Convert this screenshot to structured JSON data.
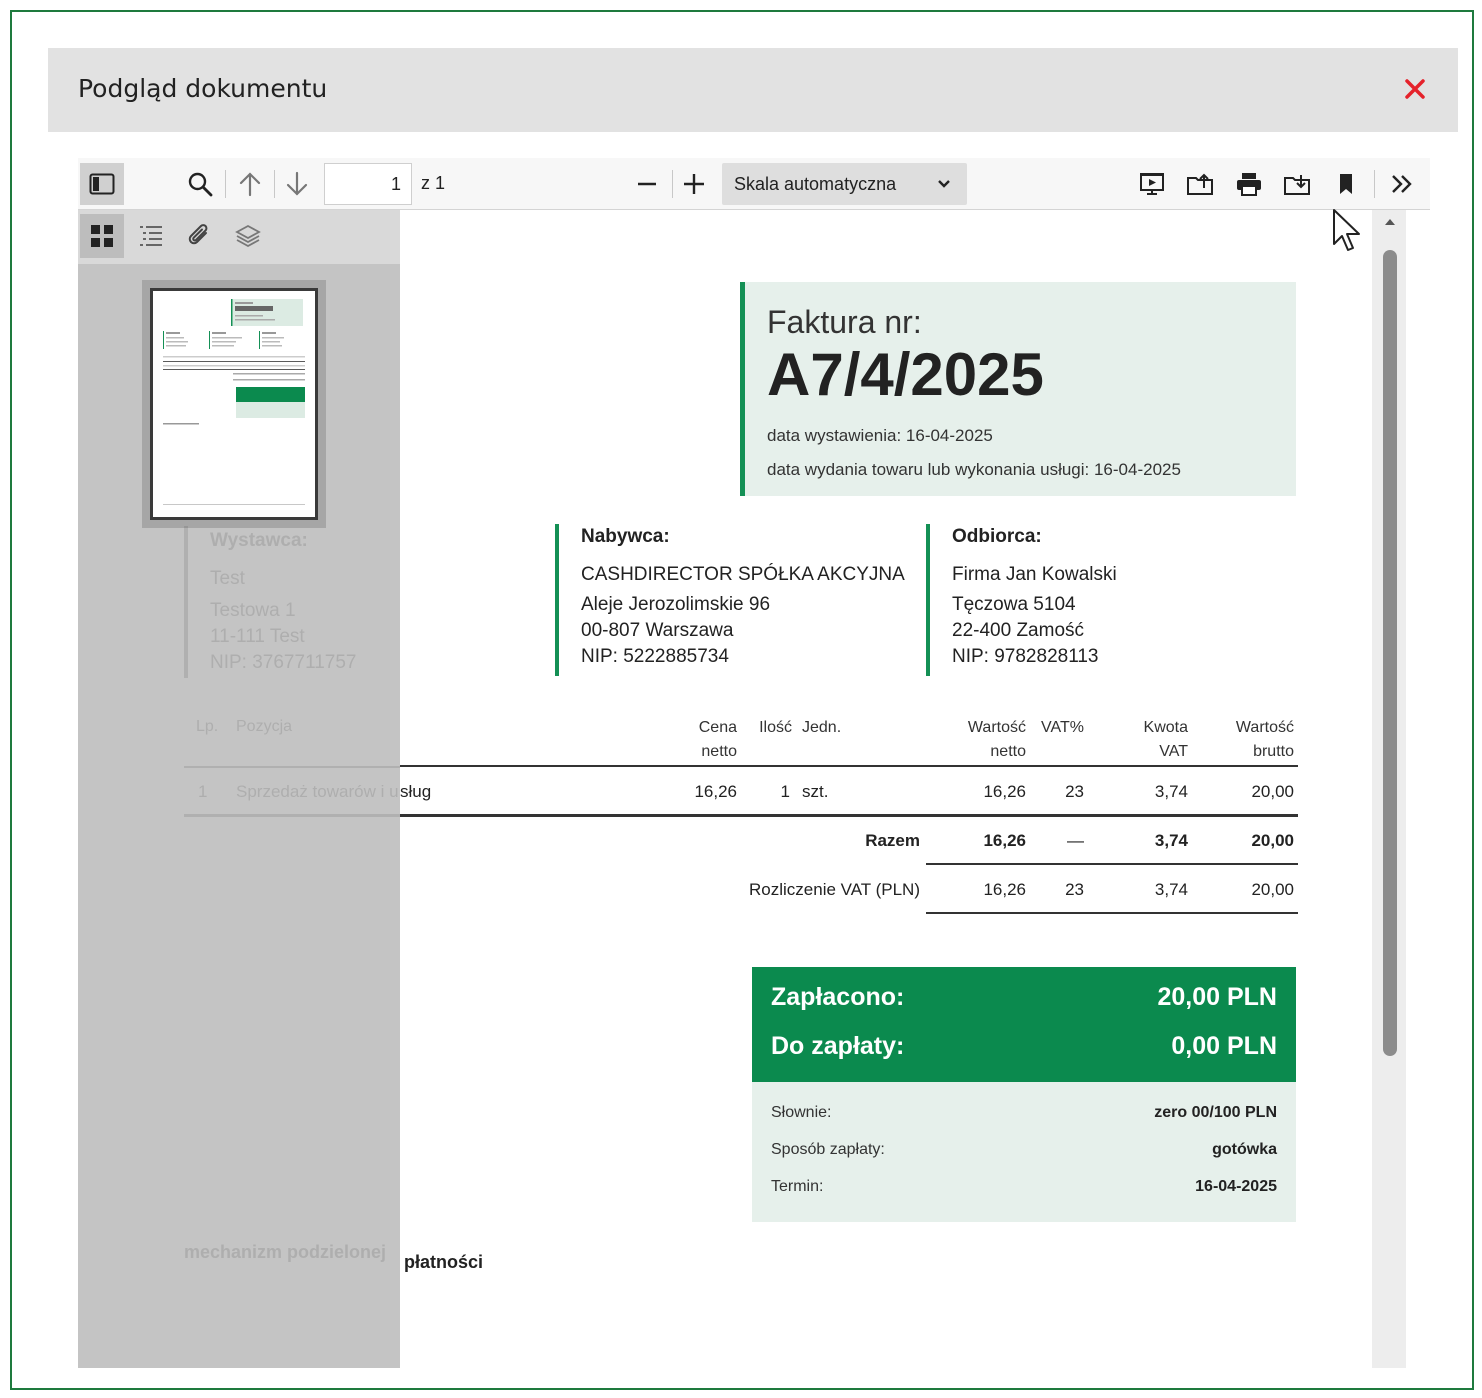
{
  "modal": {
    "title": "Podgląd dokumentu"
  },
  "toolbar": {
    "page_number": "1",
    "page_of": "z 1",
    "scale": "Skala automatyczna"
  },
  "invoice": {
    "label": "Faktura nr:",
    "number": "A7/4/2025",
    "issue_date": "data wystawienia: 16-04-2025",
    "delivery_date": "data wydania towaru lub wykonania usługi: 16-04-2025"
  },
  "buyer": {
    "title": "Nabywca:",
    "name": "CASHDIRECTOR SPÓŁKA AKCYJNA",
    "street": "Aleje Jerozolimskie 96",
    "city": "00-807 Warszawa",
    "nip": "NIP: 5222885734"
  },
  "recipient": {
    "title": "Odbiorca:",
    "name": "Firma Jan Kowalski",
    "street": "Tęczowa 5104",
    "city": "22-400 Zamość",
    "nip": "NIP: 9782828113"
  },
  "seller_ghost": {
    "title": "Wystawca:",
    "name": "Test",
    "street": "Testowa 1",
    "city": "11-111 Test",
    "nip": "NIP: 3767711757"
  },
  "table": {
    "headers": {
      "lp": "Lp.",
      "item": "Pozycja",
      "price_1": "Cena",
      "price_2": "netto",
      "qty": "Ilość",
      "unit": "Jedn.",
      "net_1": "Wartość",
      "net_2": "netto",
      "vat": "VAT%",
      "vat_amt_1": "Kwota",
      "vat_amt_2": "VAT",
      "gross_1": "Wartość",
      "gross_2": "brutto"
    },
    "rows": [
      {
        "lp": "1",
        "item_hidden": "Sprzedaż towarów i u",
        "item_visible": "sług",
        "price": "16,26",
        "qty": "1",
        "unit": "szt.",
        "net": "16,26",
        "vat": "23",
        "vat_amt": "3,74",
        "gross": "20,00"
      }
    ],
    "total": {
      "label": "Razem",
      "net": "16,26",
      "vat": "—",
      "vat_amt": "3,74",
      "gross": "20,00"
    },
    "vat_settlement": {
      "label": "Rozliczenie VAT (PLN)",
      "net": "16,26",
      "vat": "23",
      "vat_amt": "3,74",
      "gross": "20,00"
    }
  },
  "payment": {
    "paid_label": "Zapłacono:",
    "paid_value": "20,00 PLN",
    "due_label": "Do zapłaty:",
    "due_value": "0,00 PLN",
    "words_label": "Słownie:",
    "words_value": "zero 00/100 PLN",
    "method_label": "Sposób zapłaty:",
    "method_value": "gotówka",
    "term_label": "Termin:",
    "term_value": "16-04-2025"
  },
  "footer": {
    "mechanism_hidden": "mechanizm podzielonej",
    "mechanism_visible": "płatności"
  },
  "colors": {
    "accent": "#149055",
    "paid_box": "#0b8a4e",
    "close": "#e5222b",
    "frame": "#1e7a3e"
  }
}
